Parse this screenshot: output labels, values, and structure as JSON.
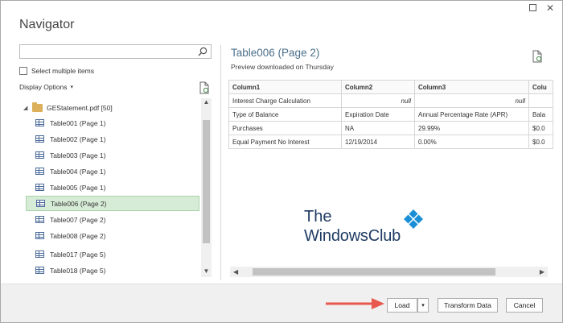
{
  "window": {
    "title": "Navigator",
    "maximize_icon": "maximize-icon",
    "close_icon": "close-icon",
    "close_glyph": "✕"
  },
  "search": {
    "value": "",
    "placeholder": "",
    "icon": "search-icon"
  },
  "select_multiple": {
    "label": "Select multiple items",
    "checked": false
  },
  "display_options": {
    "label": "Display Options",
    "chevron": "▾"
  },
  "tree": {
    "root": {
      "label": "GEStatement.pdf [50]",
      "caret": "◢"
    },
    "items": [
      {
        "label": "Table001 (Page 1)",
        "selected": false
      },
      {
        "label": "Table002 (Page 1)",
        "selected": false
      },
      {
        "label": "Table003 (Page 1)",
        "selected": false
      },
      {
        "label": "Table004 (Page 1)",
        "selected": false
      },
      {
        "label": "Table005 (Page 1)",
        "selected": false
      },
      {
        "label": "Table006 (Page 2)",
        "selected": true
      },
      {
        "label": "Table007 (Page 2)",
        "selected": false
      },
      {
        "label": "Table008 (Page 2)",
        "selected": false
      },
      {
        "label": "Table017 (Page 5)",
        "selected": false
      },
      {
        "label": "Table018 (Page 5)",
        "selected": false
      }
    ]
  },
  "preview": {
    "title": "Table006 (Page 2)",
    "subtitle": "Preview downloaded on Thursday",
    "table": {
      "headers": [
        "Column1",
        "Column2",
        "Column3",
        "Colu"
      ],
      "rows": [
        [
          "Interest Charge Calculation",
          "null",
          "null",
          ""
        ],
        [
          "Type of Balance",
          "Expiration Date",
          "Annual Percentage Rate (APR)",
          "Bala"
        ],
        [
          "Purchases",
          "NA",
          "29.99%",
          "$0.0"
        ],
        [
          "Equal Payment No Interest",
          "12/19/2014",
          "0.00%",
          "$0.0"
        ]
      ]
    }
  },
  "watermark": {
    "line1": "The",
    "line2": "WindowsClub"
  },
  "scroll": {
    "up": "▲",
    "down": "▼",
    "left": "◀",
    "right": "▶"
  },
  "buttons": {
    "load": "Load",
    "load_dropdown": "▾",
    "transform": "Transform Data",
    "cancel": "Cancel"
  },
  "colors": {
    "selected_bg": "#d7ecd7",
    "title_accent": "#4a6f8a",
    "arrow": "#e8584c",
    "watermark": "#1f3c63",
    "watermark_logo": "#1a8fd6"
  }
}
